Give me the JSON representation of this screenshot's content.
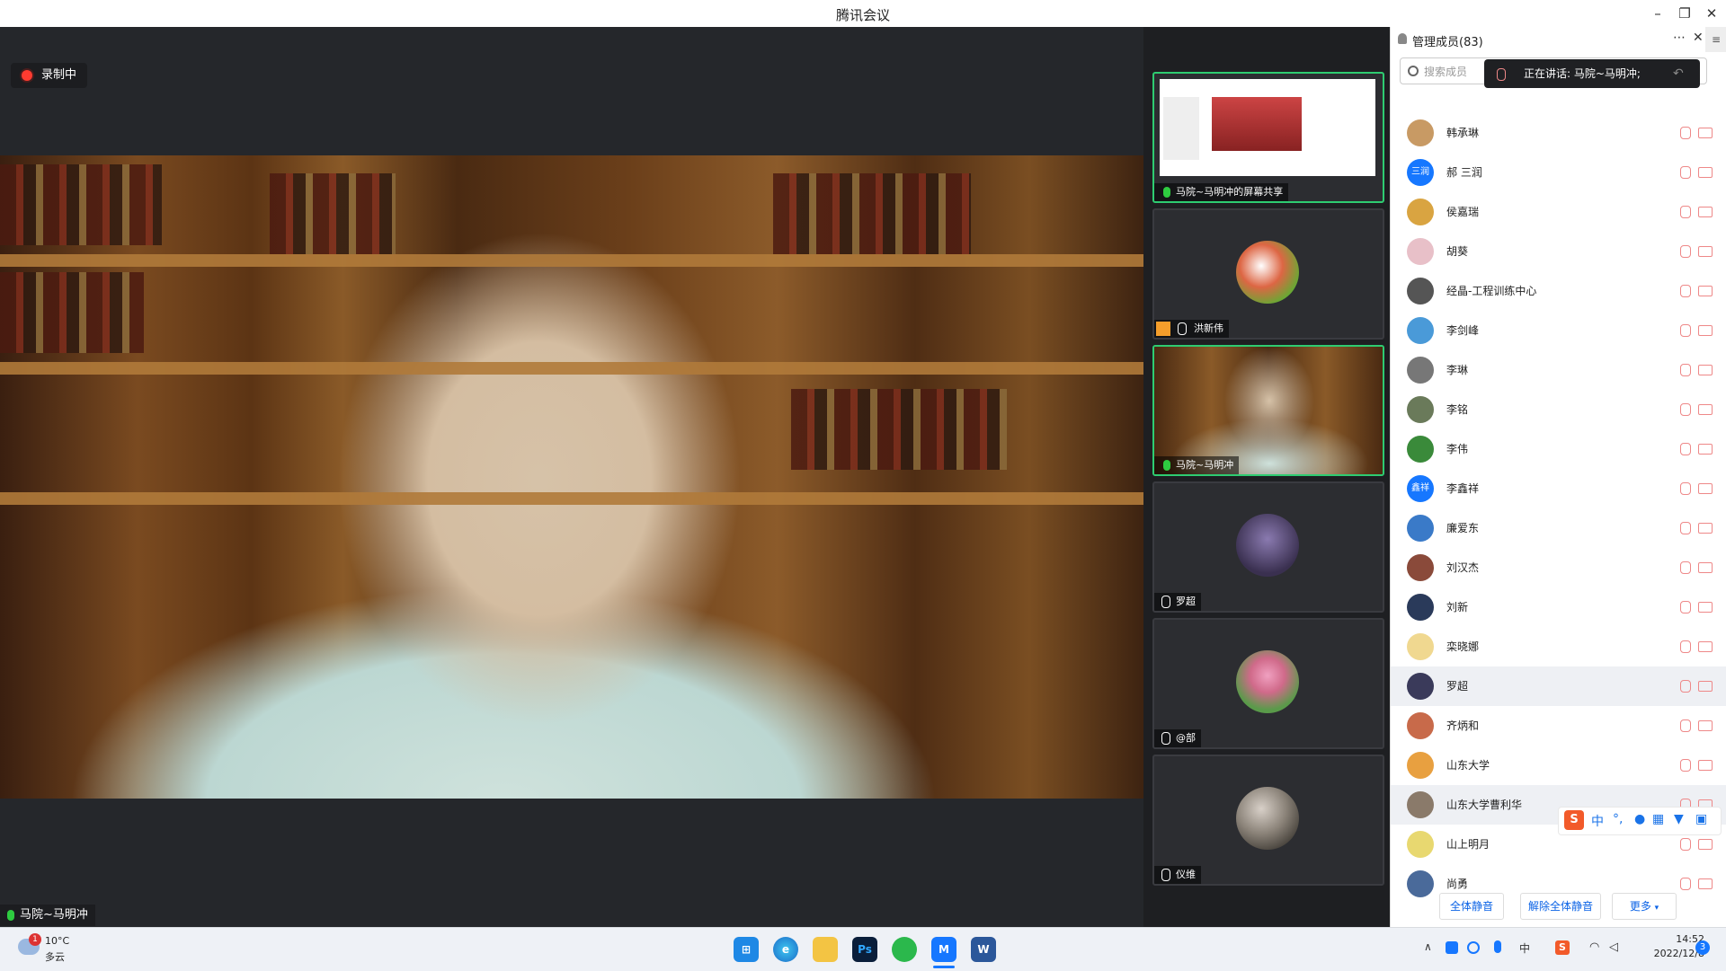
{
  "window": {
    "title": "腾讯会议"
  },
  "recording": {
    "label": "录制中"
  },
  "speaker": {
    "name": "马院~马明冲"
  },
  "tiles": [
    {
      "name": "马院~马明冲的屏幕共享",
      "muted": false
    },
    {
      "name": "洪新伟",
      "muted": true
    },
    {
      "name": "马院~马明冲",
      "muted": false
    },
    {
      "name": "罗超",
      "muted": true
    },
    {
      "name": "@部",
      "muted": true
    },
    {
      "name": "仪维",
      "muted": true
    }
  ],
  "panel": {
    "title": "管理成员(83)",
    "search_placeholder": "搜索成员",
    "speaking": "正在讲话: 马院~马明冲;",
    "members": [
      {
        "name": "韩承琳",
        "avatar_text": "",
        "color": "#c89a64"
      },
      {
        "name": "郝 三润",
        "avatar_text": "三润",
        "color": "#1677ff"
      },
      {
        "name": "侯嘉瑞",
        "avatar_text": "",
        "color": "#d9a441"
      },
      {
        "name": "胡葵",
        "avatar_text": "",
        "color": "#e8c0c8"
      },
      {
        "name": "经晶-工程训练中心",
        "avatar_text": "",
        "color": "#555555"
      },
      {
        "name": "李剑峰",
        "avatar_text": "",
        "color": "#4a9ad8"
      },
      {
        "name": "李琳",
        "avatar_text": "",
        "color": "#777777"
      },
      {
        "name": "李铭",
        "avatar_text": "",
        "color": "#6a7a5a"
      },
      {
        "name": "李伟",
        "avatar_text": "",
        "color": "#3a8a3a"
      },
      {
        "name": "李鑫祥",
        "avatar_text": "鑫祥",
        "color": "#1677ff"
      },
      {
        "name": "廉爱东",
        "avatar_text": "",
        "color": "#3a7ac8"
      },
      {
        "name": "刘汉杰",
        "avatar_text": "",
        "color": "#8a4a3a"
      },
      {
        "name": "刘新",
        "avatar_text": "",
        "color": "#2a3a5a"
      },
      {
        "name": "栾晓娜",
        "avatar_text": "",
        "color": "#f0d890"
      },
      {
        "name": "罗超",
        "avatar_text": "",
        "color": "#3a3a5a"
      },
      {
        "name": "齐炳和",
        "avatar_text": "",
        "color": "#c86a4a"
      },
      {
        "name": "山东大学",
        "avatar_text": "",
        "color": "#e8a040"
      },
      {
        "name": "山东大学曹利华",
        "avatar_text": "",
        "color": "#8a7a6a"
      },
      {
        "name": "山上明月",
        "avatar_text": "",
        "color": "#e8d870"
      },
      {
        "name": "尚勇",
        "avatar_text": "",
        "color": "#4a6a9a"
      }
    ],
    "buttons": {
      "mute_all": "全体静音",
      "unmute_all": "解除全体静音",
      "more": "更多"
    }
  },
  "ime": {
    "mode": "中",
    "punct": "°,"
  },
  "taskbar": {
    "weather_temp": "10°C",
    "weather_desc": "多云",
    "weather_badge": "1",
    "time": "14:52",
    "date": "2022/12/8",
    "notify_count": "3",
    "ime_label": "中",
    "apps": [
      "start-icon",
      "edge-icon",
      "file-explorer-icon",
      "photoshop-icon",
      "wechat-icon",
      "tencent-meeting-icon",
      "word-icon"
    ]
  }
}
